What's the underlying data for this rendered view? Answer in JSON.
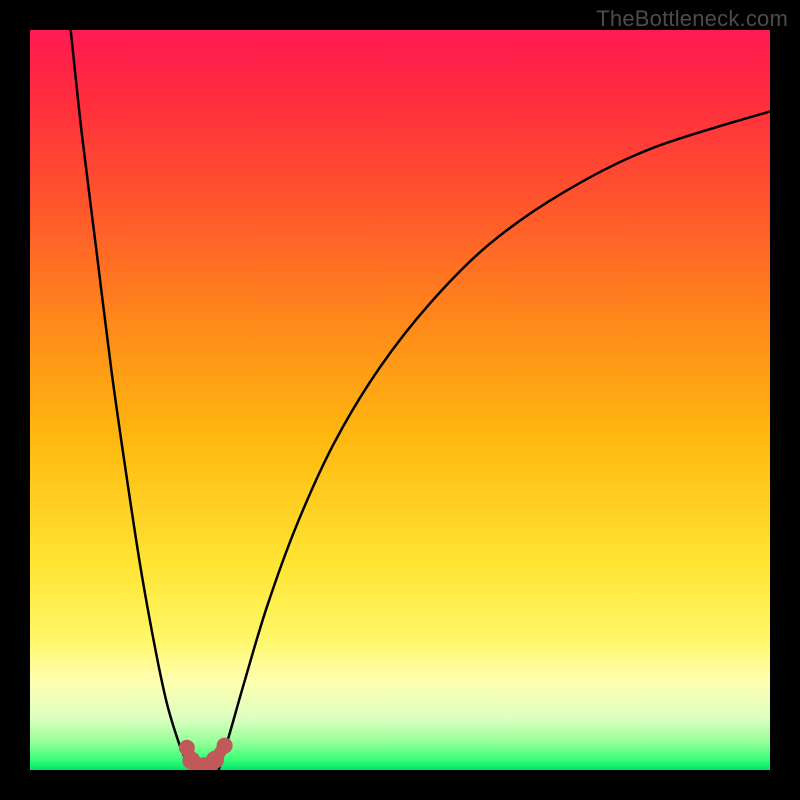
{
  "watermark": "TheBottleneck.com",
  "chart_data": {
    "type": "line",
    "title": "",
    "xlabel": "",
    "ylabel": "",
    "xlim": [
      0,
      100
    ],
    "ylim": [
      0,
      100
    ],
    "grid": false,
    "background_gradient_stops": [
      {
        "offset": 0.0,
        "color": "#ff1a52"
      },
      {
        "offset": 0.1,
        "color": "#ff2e3d"
      },
      {
        "offset": 0.25,
        "color": "#ff5a2b"
      },
      {
        "offset": 0.4,
        "color": "#ff8a1a"
      },
      {
        "offset": 0.55,
        "color": "#ffb80f"
      },
      {
        "offset": 0.72,
        "color": "#ffe433"
      },
      {
        "offset": 0.82,
        "color": "#fff766"
      },
      {
        "offset": 0.88,
        "color": "#ffffb0"
      },
      {
        "offset": 0.93,
        "color": "#dcffc0"
      },
      {
        "offset": 0.96,
        "color": "#9cff9c"
      },
      {
        "offset": 0.985,
        "color": "#3cff78"
      },
      {
        "offset": 1.0,
        "color": "#00e56a"
      }
    ],
    "series": [
      {
        "name": "left-curve",
        "stroke": "#000000",
        "x": [
          5.5,
          7,
          9,
          11,
          13,
          15,
          17,
          18.5,
          20,
          21,
          22
        ],
        "y": [
          100,
          86,
          70,
          54,
          40,
          27,
          16,
          9,
          4,
          1.5,
          0
        ]
      },
      {
        "name": "right-curve",
        "stroke": "#000000",
        "x": [
          25.5,
          27,
          29,
          32,
          36,
          41,
          47,
          54,
          62,
          72,
          84,
          100
        ],
        "y": [
          0,
          5,
          12,
          22,
          33,
          44,
          54,
          63,
          71,
          78,
          84,
          89
        ]
      },
      {
        "name": "dip-markers",
        "stroke": "#c05a5a",
        "type": "scatter",
        "x": [
          21.2,
          21.8,
          22.6,
          23.4,
          24.2,
          25.0,
          26.3
        ],
        "y": [
          3.0,
          1.3,
          0.5,
          0.5,
          0.6,
          1.4,
          3.3
        ]
      }
    ]
  }
}
